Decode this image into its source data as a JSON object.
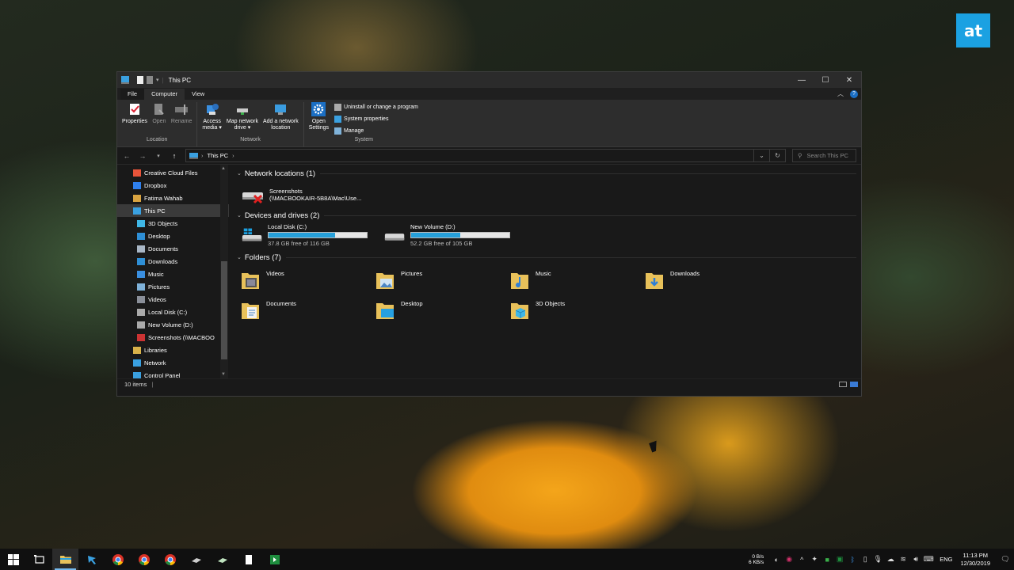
{
  "brand": {
    "logo_text": "at"
  },
  "window": {
    "title": "This PC",
    "tabs": [
      "File",
      "Computer",
      "View"
    ]
  },
  "ribbon": {
    "location": {
      "label": "Location",
      "buttons": [
        "Properties",
        "Open",
        "Rename"
      ]
    },
    "network": {
      "label": "Network",
      "buttons": [
        {
          "l1": "Access",
          "l2": "media ▾"
        },
        {
          "l1": "Map network",
          "l2": "drive ▾"
        },
        {
          "l1": "Add a network",
          "l2": "location"
        }
      ]
    },
    "system": {
      "label": "System",
      "open_settings_1": "Open",
      "open_settings_2": "Settings",
      "small": [
        "Uninstall or change a program",
        "System properties",
        "Manage"
      ]
    }
  },
  "address": {
    "path": "This PC",
    "search_placeholder": "Search This PC"
  },
  "nav": {
    "items": [
      {
        "label": "Creative Cloud Files",
        "indent": 0,
        "color": "#e8543a"
      },
      {
        "label": "Dropbox",
        "indent": 0,
        "color": "#2f80ed"
      },
      {
        "label": "Fatima Wahab",
        "indent": 0,
        "color": "#d9a441"
      },
      {
        "label": "This PC",
        "indent": 0,
        "color": "#3aa0e0",
        "selected": true
      },
      {
        "label": "3D Objects",
        "indent": 1,
        "color": "#3fb7e6"
      },
      {
        "label": "Desktop",
        "indent": 1,
        "color": "#2e8fd6"
      },
      {
        "label": "Documents",
        "indent": 1,
        "color": "#a9b7c6"
      },
      {
        "label": "Downloads",
        "indent": 1,
        "color": "#2e8fd6"
      },
      {
        "label": "Music",
        "indent": 1,
        "color": "#3a8fe0"
      },
      {
        "label": "Pictures",
        "indent": 1,
        "color": "#7fb2d9"
      },
      {
        "label": "Videos",
        "indent": 1,
        "color": "#8a8f99"
      },
      {
        "label": "Local Disk (C:)",
        "indent": 1,
        "color": "#aaaaaa"
      },
      {
        "label": "New Volume (D:)",
        "indent": 1,
        "color": "#aaaaaa"
      },
      {
        "label": "Screenshots (\\\\MACBOO",
        "indent": 1,
        "color": "#cc3333"
      },
      {
        "label": "Libraries",
        "indent": 0,
        "color": "#d9b24a"
      },
      {
        "label": "Network",
        "indent": 0,
        "color": "#3aa0e0"
      },
      {
        "label": "Control Panel",
        "indent": 0,
        "color": "#3aa0e0"
      }
    ]
  },
  "sections": {
    "network": "Network locations (1)",
    "devices": "Devices and drives (2)",
    "folders": "Folders (7)"
  },
  "network_location": {
    "name": "Screenshots",
    "path": "(\\\\MACBOOKAIR-5B8A\\Mac\\Use..."
  },
  "drives": [
    {
      "name": "Local Disk (C:)",
      "free": "37.8 GB free of 116 GB",
      "used_fraction": 0.674
    },
    {
      "name": "New Volume (D:)",
      "free": "52.2 GB free of 105 GB",
      "used_fraction": 0.503
    }
  ],
  "folders": [
    "Videos",
    "Pictures",
    "Music",
    "Downloads",
    "Documents",
    "Desktop",
    "3D Objects"
  ],
  "status": {
    "items": "10 items"
  },
  "tray": {
    "net_up": "0 B/s",
    "net_down": "6 KB/s",
    "lang": "ENG",
    "time": "11:13 PM",
    "date": "12/30/2019"
  }
}
